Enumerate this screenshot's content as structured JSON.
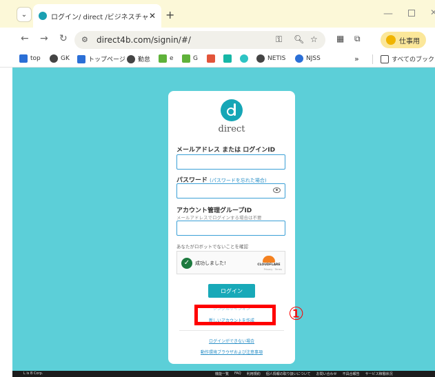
{
  "browser": {
    "tab_title": "ログイン/ direct /ビジネスチャット | d",
    "tab_close": "✕",
    "new_tab": "+",
    "url": "direct4b.com/signin/#/",
    "profile_label": "仕事用"
  },
  "bookmarks": [
    {
      "label": "top",
      "icon": "bookmark-top-icon",
      "color": "#2b6fd6"
    },
    {
      "label": "GK",
      "icon": "bookmark-gk-icon",
      "color": "#444444"
    },
    {
      "label": "トップページ",
      "icon": "bookmark-toppage-icon",
      "color": "#2b6fd6"
    },
    {
      "label": "勤怠",
      "icon": "bookmark-kintai-icon",
      "color": "#444444"
    },
    {
      "label": "e",
      "icon": "bookmark-e-icon",
      "color": "#5fb23a"
    },
    {
      "label": "G",
      "icon": "bookmark-g-icon",
      "color": "#5fb23a"
    },
    {
      "label": "NETIS",
      "icon": "bookmark-netis-icon",
      "color": "#444444"
    },
    {
      "label": "NJSS",
      "icon": "bookmark-njss-icon",
      "color": "#2b6fd6"
    },
    {
      "label": "すべてのブックマーク",
      "icon": "folder-icon",
      "color": "#444444"
    }
  ],
  "bookmark_overflow": "»",
  "card": {
    "logo_text": "direct",
    "email_label": "メールアドレス または ログインID",
    "password_label": "パスワード",
    "forgot_password_link": "(パスワードを忘れた場合)",
    "account_group_label": "アカウント管理グループID",
    "account_group_hint": "メールアドレスでログインする場合は不要",
    "robot_note": "あなたがロボットでないことを確認",
    "captcha_success": "成功しました!",
    "captcha_brand": "CLOUDFLARE",
    "captcha_links": "Privacy · Terms",
    "login_button": "ログイン",
    "sso_link": "シングルサインオン",
    "new_account_link": "新しいアカウントを作成",
    "cant_login_link": "ログインができない場合",
    "env_link": "動作環境ブラウザおよび注意事項"
  },
  "annotation": {
    "callout_number": "①",
    "highlight_color": "#ff0000"
  },
  "footer": {
    "copyright": "L is B Corp.",
    "links": [
      "機能一覧",
      "FAQ",
      "利用規約",
      "個人情報の取り扱いについて",
      "お問い合わせ",
      "不具合報告",
      "サービス稼働状況"
    ]
  },
  "colors": {
    "page_background": "#5ccfd8",
    "brand": "#18a9b8",
    "link": "#2a8fc7"
  }
}
